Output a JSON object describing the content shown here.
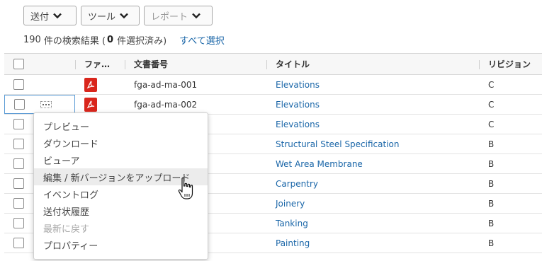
{
  "toolbar": {
    "send_label": "送付",
    "tools_label": "ツール",
    "report_label": "レポート"
  },
  "results": {
    "count": "190",
    "prefix": "件の検索結果 (",
    "selected": "0",
    "suffix": "件選択済み)",
    "select_all": "すべて選択"
  },
  "table": {
    "headers": {
      "file": "ファ…",
      "doc_number": "文書番号",
      "title": "タイトル",
      "revision": "リビジョン"
    },
    "rows": [
      {
        "doc": "fga-ad-ma-001",
        "title": "Elevations",
        "rev": "C"
      },
      {
        "doc": "fga-ad-ma-002",
        "title": "Elevations",
        "rev": "C"
      },
      {
        "doc": "",
        "title": "Elevations",
        "rev": "C"
      },
      {
        "doc": "",
        "title": "Structural Steel Specification",
        "rev": "B"
      },
      {
        "doc": "",
        "title": "Wet Area Membrane",
        "rev": "B"
      },
      {
        "doc": "",
        "title": "Carpentry",
        "rev": "B"
      },
      {
        "doc": "",
        "title": "Joinery",
        "rev": "B"
      },
      {
        "doc": "",
        "title": "Tanking",
        "rev": "B"
      },
      {
        "doc": "",
        "title": "Painting",
        "rev": "B"
      }
    ]
  },
  "context_menu": {
    "items": [
      {
        "label": "プレビュー"
      },
      {
        "label": "ダウンロード"
      },
      {
        "label": "ビューア"
      },
      {
        "label": "編集 / 新バージョンをアップロード"
      },
      {
        "label": "イベントログ"
      },
      {
        "label": "送付状履歴"
      },
      {
        "label": "最新に戻す"
      },
      {
        "label": "プロパティー"
      }
    ]
  },
  "icons": {
    "file_type": "pdf-icon",
    "row_actions": "more-actions-icon",
    "cursor": "hand-pointer-icon"
  },
  "colors": {
    "link": "#1a66a8",
    "pdf": "#d9261c",
    "menu_hover": "#ececec"
  }
}
